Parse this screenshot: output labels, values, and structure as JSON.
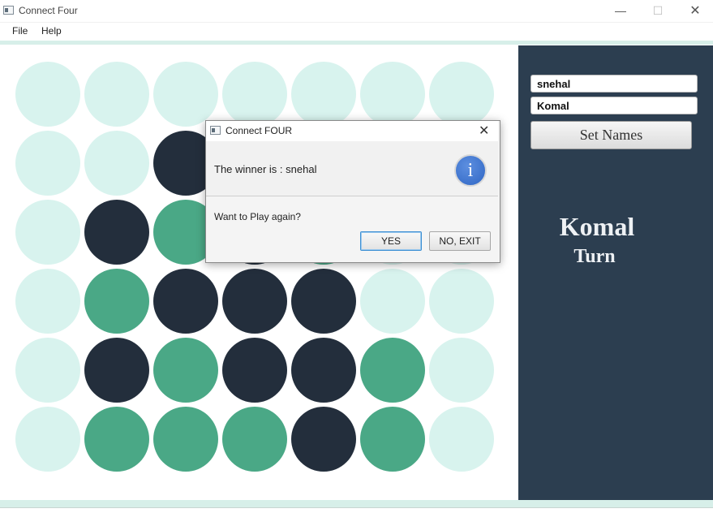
{
  "window": {
    "title": "Connect Four",
    "minimize_icon": "—",
    "maximize_icon": "☐",
    "close_icon": "✕"
  },
  "menu": {
    "file": "File",
    "help": "Help"
  },
  "board": {
    "rows": 6,
    "cols": 7,
    "colors": {
      "empty": "#d8f3ee",
      "dark": "#232e3c",
      "green": "#4aa886"
    },
    "grid": [
      [
        "empty",
        "empty",
        "empty",
        "empty",
        "empty",
        "empty",
        "empty"
      ],
      [
        "empty",
        "empty",
        "dark",
        "empty",
        "empty",
        "empty",
        "empty"
      ],
      [
        "empty",
        "dark",
        "green",
        "dark",
        "green",
        "empty",
        "empty"
      ],
      [
        "empty",
        "green",
        "dark",
        "dark",
        "dark",
        "empty",
        "empty"
      ],
      [
        "empty",
        "dark",
        "green",
        "dark",
        "dark",
        "green",
        "empty"
      ],
      [
        "empty",
        "green",
        "green",
        "green",
        "dark",
        "green",
        "empty"
      ]
    ]
  },
  "side_panel": {
    "player_one_value": "snehal",
    "player_two_value": "Komal",
    "set_names_label": "Set Names",
    "turn_player": "Komal",
    "turn_label": "Turn",
    "background": "#2c3e50"
  },
  "dialog": {
    "title": "Connect FOUR",
    "close_icon": "✕",
    "header_text": "The winner is : snehal",
    "info_icon_glyph": "i",
    "content_text": "Want to Play again?",
    "yes_label": "YES",
    "no_label": "NO, EXIT"
  }
}
